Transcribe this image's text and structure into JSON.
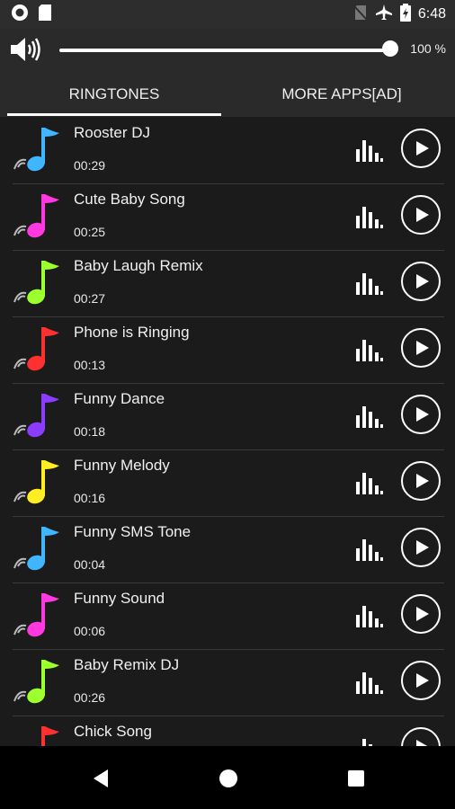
{
  "status": {
    "time": "6:48",
    "icons": [
      "record-icon",
      "sd-card-icon",
      "no-sim-icon",
      "airplane-icon",
      "battery-charging-icon"
    ]
  },
  "volume": {
    "level": 1.0,
    "label": "100 %"
  },
  "tabs": [
    {
      "label": "RINGTONES",
      "active": true
    },
    {
      "label": "MORE APPS[AD]",
      "active": false
    }
  ],
  "ringtones": [
    {
      "title": "Rooster DJ",
      "duration": "00:29",
      "color": "#3fb6ff"
    },
    {
      "title": "Cute Baby Song",
      "duration": "00:25",
      "color": "#ff38e0"
    },
    {
      "title": "Baby Laugh Remix",
      "duration": "00:27",
      "color": "#9cff2e"
    },
    {
      "title": "Phone is Ringing",
      "duration": "00:13",
      "color": "#ff3030"
    },
    {
      "title": "Funny Dance",
      "duration": "00:18",
      "color": "#8b3cff"
    },
    {
      "title": "Funny Melody",
      "duration": "00:16",
      "color": "#ffee22"
    },
    {
      "title": "Funny SMS Tone",
      "duration": "00:04",
      "color": "#3fb6ff"
    },
    {
      "title": "Funny Sound",
      "duration": "00:06",
      "color": "#ff38e0"
    },
    {
      "title": "Baby Remix DJ",
      "duration": "00:26",
      "color": "#9cff2e"
    },
    {
      "title": "Chick Song",
      "duration": "",
      "color": "#ff3030"
    }
  ],
  "nav": {
    "icons": [
      "back-icon",
      "home-icon",
      "recents-icon"
    ]
  }
}
